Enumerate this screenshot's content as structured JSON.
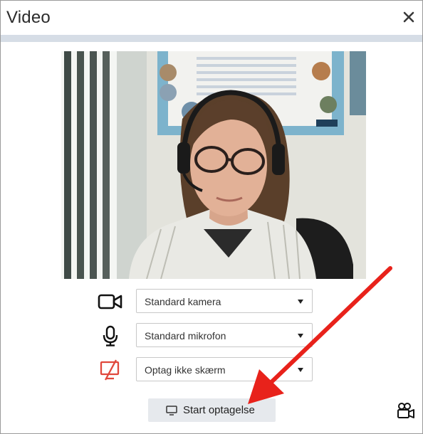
{
  "dialog": {
    "title": "Video",
    "close_icon": "close-icon"
  },
  "preview": {
    "icon": "webcam-preview"
  },
  "camera": {
    "icon": "video-camera-icon",
    "selected": "Standard kamera"
  },
  "microphone": {
    "icon": "microphone-icon",
    "selected": "Standard mikrofon"
  },
  "screen": {
    "icon": "screen-off-icon",
    "selected": "Optag ikke skærm",
    "icon_color": "#e0483c"
  },
  "actions": {
    "start_label": "Start optagelse",
    "start_icon": "monitor-icon",
    "recorder_icon": "film-camera-icon"
  },
  "annotation": {
    "arrow_color": "#e8221b"
  }
}
